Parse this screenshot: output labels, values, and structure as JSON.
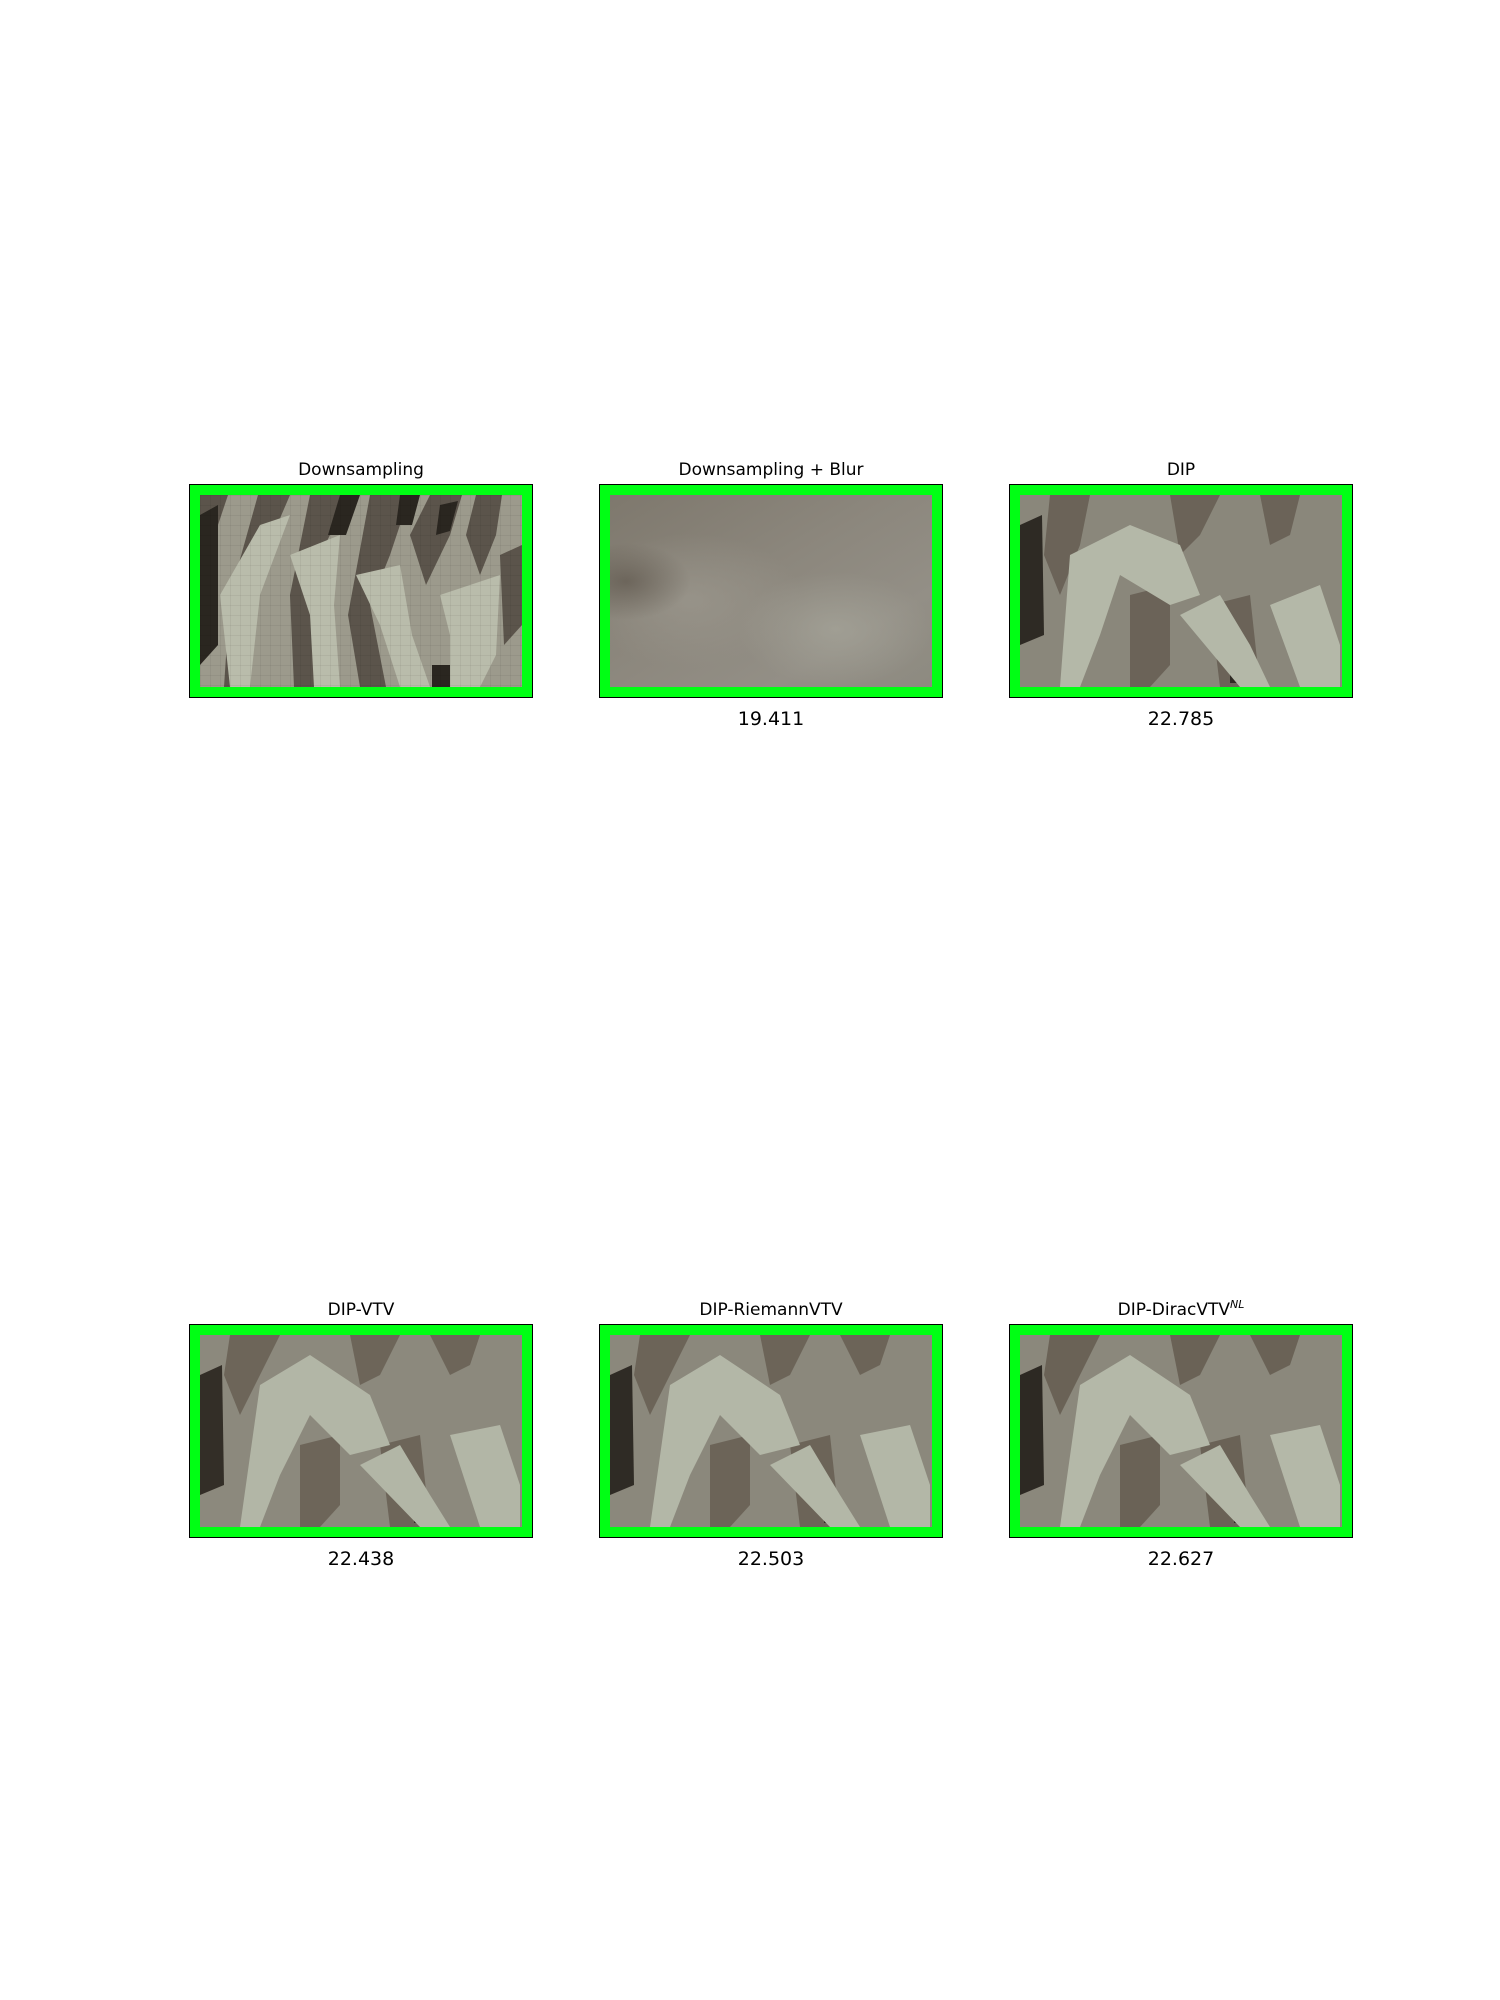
{
  "figure": {
    "panels": [
      {
        "title": "Downsampling",
        "title_sup": "",
        "value": ""
      },
      {
        "title": "Downsampling + Blur",
        "title_sup": "",
        "value": "19.411"
      },
      {
        "title": "DIP",
        "title_sup": "",
        "value": "22.785"
      },
      {
        "title": "DIP-VTV",
        "title_sup": "",
        "value": "22.438"
      },
      {
        "title": "DIP-RiemannVTV",
        "title_sup": "",
        "value": "22.503"
      },
      {
        "title": "DIP-DiracVTV",
        "title_sup": "NL",
        "value": "22.627"
      }
    ],
    "colors": {
      "frame_border": "#00ff14",
      "background": "#ffffff"
    }
  }
}
